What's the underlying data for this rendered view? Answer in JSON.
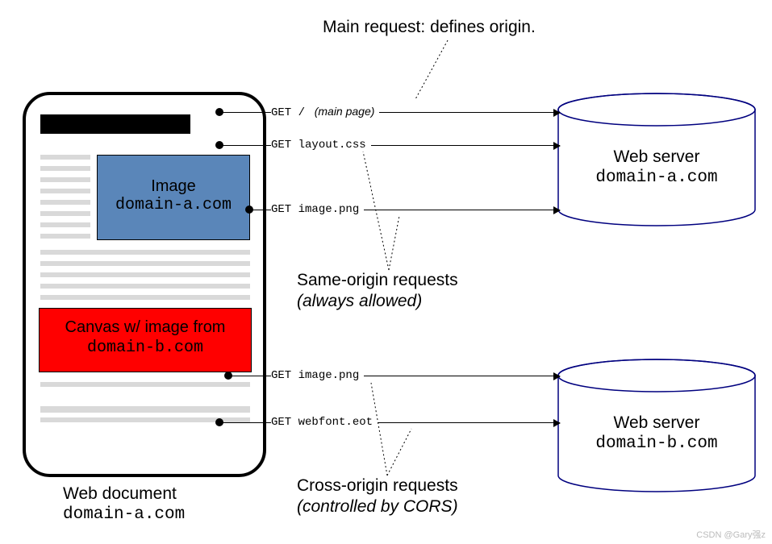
{
  "title": "Main request: defines origin.",
  "document": {
    "caption_line1": "Web document",
    "caption_line2": "domain-a.com",
    "image_box": {
      "label": "Image",
      "domain": "domain-a.com"
    },
    "canvas_box": {
      "label": "Canvas w/ image from",
      "domain": "domain-b.com"
    }
  },
  "servers": {
    "a": {
      "label": "Web server",
      "domain": "domain-a.com"
    },
    "b": {
      "label": "Web server",
      "domain": "domain-b.com"
    }
  },
  "requests": {
    "main": {
      "method": "GET",
      "path": "/",
      "note": "(main page)"
    },
    "css": {
      "method": "GET",
      "path": "layout.css"
    },
    "imgA": {
      "method": "GET",
      "path": "image.png"
    },
    "imgB": {
      "method": "GET",
      "path": "image.png"
    },
    "webfont": {
      "method": "GET",
      "path": "webfont.eot"
    }
  },
  "annotations": {
    "same": {
      "line1": "Same-origin requests",
      "line2": "(always allowed)"
    },
    "cross": {
      "line1": "Cross-origin requests",
      "line2": "(controlled by CORS)"
    }
  },
  "watermark": "CSDN @Gary强z"
}
